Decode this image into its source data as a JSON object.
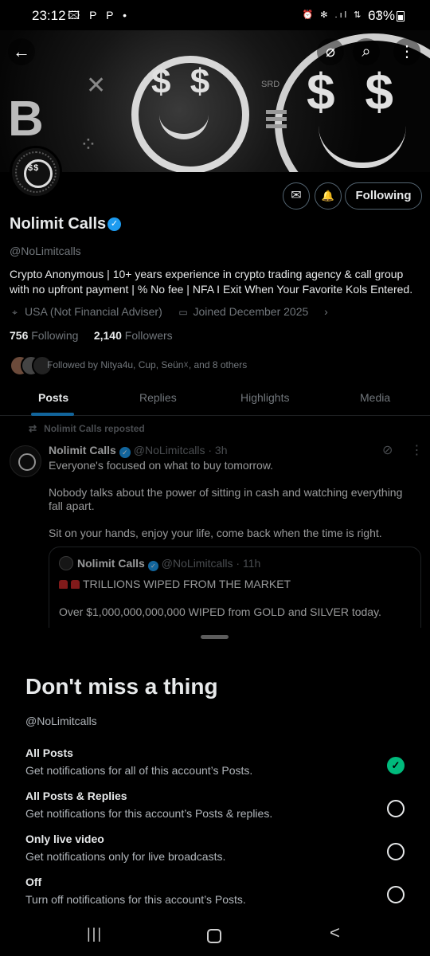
{
  "status_bar": {
    "time": "23:12",
    "left_icons": "🖾 P P •",
    "right_icons": "⏰ ✻ .ıl ⇅ .ıl",
    "battery": "63%"
  },
  "banner": {
    "btc": "B",
    "xmark": "✕",
    "dots": "⁘",
    "eyes_small": "$ $",
    "eyes_large": "$ $",
    "srd": "SRD",
    "back_icon": "←",
    "grok_icon": "⌀",
    "search_icon": "⌕",
    "more_icon": "⋮"
  },
  "avatar": {
    "eyes": "$$"
  },
  "profile": {
    "name": "Nolimit Calls",
    "handle": "@NoLimitcalls",
    "bio": "Crypto Anonymous | 10+ years experience in crypto trading agency & call group with no upfront payment | % No fee | NFA I Exit When Your Favorite Kols Entered.",
    "location": "USA (Not Financial Adviser)",
    "joined": "Joined December 2025",
    "following_count": "756",
    "following_label": "Following",
    "followers_count": "2,140",
    "followers_label": "Followers",
    "followed_by": "Followed by Nitya4u, Cup, Seün☓, and 8 others",
    "following_button": "Following",
    "message_icon": "✉",
    "bell_icon": "🔔"
  },
  "tabs": [
    {
      "label": "Posts"
    },
    {
      "label": "Replies"
    },
    {
      "label": "Highlights"
    },
    {
      "label": "Media"
    }
  ],
  "post": {
    "repost_icon": "⇄",
    "repost_text": "Nolimit Calls reposted",
    "name": "Nolimit Calls",
    "handle_time": "@NoLimitcalls · 3h",
    "paragraphs": [
      "Everyone's focused on what to buy tomorrow.",
      "Nobody talks about the power of sitting in cash and watching everything fall apart.",
      "Sit on your hands, enjoy your life, come back when the time is right."
    ],
    "grok_icon": "⊘",
    "more_icon": "⋮",
    "quote": {
      "name": "Nolimit Calls",
      "handle_time": "@NoLimitcalls · 11h",
      "line1": "TRILLIONS WIPED FROM THE MARKET",
      "line2": "Over $1,000,000,000,000 WIPED from GOLD and SILVER today."
    }
  },
  "sheet": {
    "title": "Don't miss a thing",
    "handle": "@NoLimitcalls",
    "options": [
      {
        "title": "All Posts",
        "desc": "Get notifications for all of this account’s Posts.",
        "selected": true,
        "check": "✓"
      },
      {
        "title": "All Posts & Replies",
        "desc": "Get notifications for this account’s Posts & replies.",
        "selected": false
      },
      {
        "title": "Only live video",
        "desc": "Get notifications only for live broadcasts.",
        "selected": false
      },
      {
        "title": "Off",
        "desc": "Turn off notifications for this account’s Posts.",
        "selected": false
      }
    ]
  },
  "navbar": {
    "recents_icon": "|||",
    "back_icon": "<"
  },
  "colors": {
    "accent": "#1d9bf0",
    "check": "#00ba7c",
    "muted": "#71767b",
    "text": "#e7e9ea"
  }
}
